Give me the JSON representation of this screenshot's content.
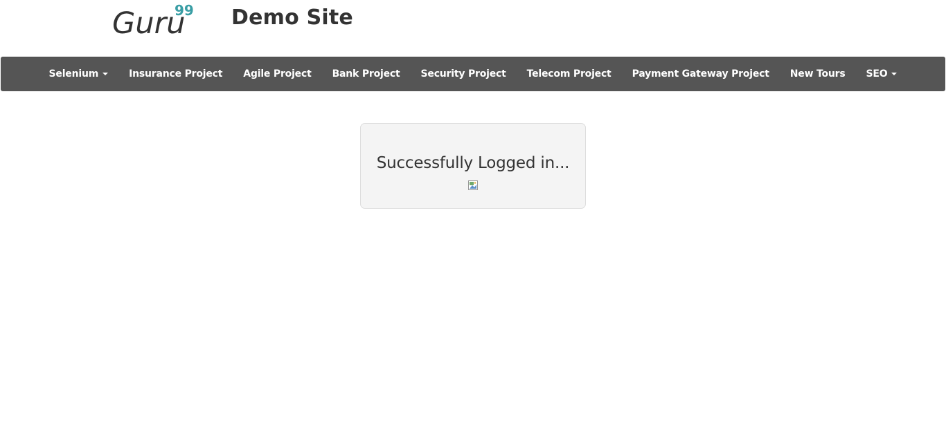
{
  "header": {
    "logo_text": "Guru",
    "logo_superscript": "99",
    "site_title": "Demo Site"
  },
  "colors": {
    "navbar_bg": "#555555",
    "logo_dark": "#333333",
    "logo_accent": "#3a9ea5",
    "panel_bg": "#f4f4f4"
  },
  "navbar": {
    "items": [
      {
        "label": "Selenium",
        "dropdown": true
      },
      {
        "label": "Insurance Project",
        "dropdown": false
      },
      {
        "label": "Agile Project",
        "dropdown": false
      },
      {
        "label": "Bank Project",
        "dropdown": false
      },
      {
        "label": "Security Project",
        "dropdown": false
      },
      {
        "label": "Telecom Project",
        "dropdown": false
      },
      {
        "label": "Payment Gateway Project",
        "dropdown": false
      },
      {
        "label": "New Tours",
        "dropdown": false
      },
      {
        "label": "SEO",
        "dropdown": true
      }
    ]
  },
  "main": {
    "message": "Successfully Logged in...",
    "image_icon": "broken-image-icon"
  }
}
